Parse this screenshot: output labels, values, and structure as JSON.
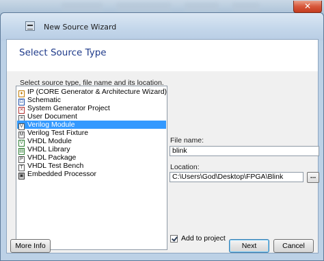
{
  "window": {
    "title": "New Source Wizard",
    "close_glyph": "✕"
  },
  "page": {
    "heading": "Select Source Type",
    "instruction": "Select source type, file name and its location."
  },
  "source_types": [
    {
      "label": "IP (CORE Generator & Architecture Wizard)",
      "icon": "ip-icon",
      "selected": false
    },
    {
      "label": "Schematic",
      "icon": "schematic-icon",
      "selected": false
    },
    {
      "label": "System Generator Project",
      "icon": "system-generator-icon",
      "selected": false
    },
    {
      "label": "User Document",
      "icon": "document-icon",
      "selected": false
    },
    {
      "label": "Verilog Module",
      "icon": "verilog-module-icon",
      "selected": true
    },
    {
      "label": "Verilog Test Fixture",
      "icon": "verilog-test-icon",
      "selected": false
    },
    {
      "label": "VHDL Module",
      "icon": "vhdl-module-icon",
      "selected": false
    },
    {
      "label": "VHDL Library",
      "icon": "vhdl-library-icon",
      "selected": false
    },
    {
      "label": "VHDL Package",
      "icon": "vhdl-package-icon",
      "selected": false
    },
    {
      "label": "VHDL Test Bench",
      "icon": "vhdl-testbench-icon",
      "selected": false
    },
    {
      "label": "Embedded Processor",
      "icon": "processor-icon",
      "selected": false
    }
  ],
  "file_name": {
    "label": "File name:",
    "value": "blink"
  },
  "location": {
    "label": "Location:",
    "value": "C:\\Users\\God\\Desktop\\FPGA\\Blink",
    "browse_label": "..."
  },
  "add_to_project": {
    "label": "Add to project",
    "checked": true
  },
  "buttons": {
    "more_info": "More Info",
    "next": "Next",
    "cancel": "Cancel"
  }
}
